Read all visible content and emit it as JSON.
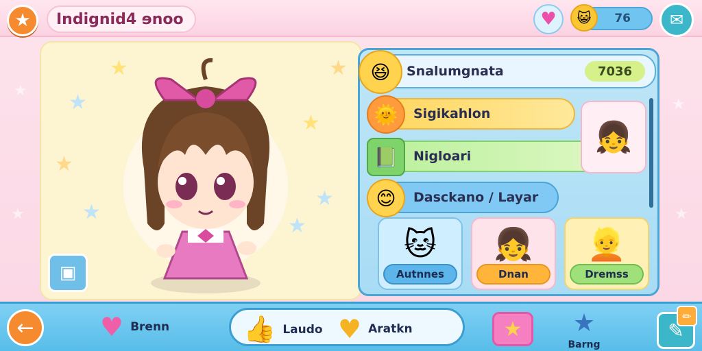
{
  "header": {
    "star_icon": "star-icon",
    "title": "Indignid4 ɘnoo",
    "heart_icon": "heart-icon",
    "coin_count": "76",
    "chat_icon": "chat-icon"
  },
  "menu": {
    "rows": [
      {
        "label": "Snalumgnata",
        "value": "7036"
      },
      {
        "label": "Sigikahlon"
      },
      {
        "label": "Nigloari"
      },
      {
        "label": "Dasckano / Layar"
      }
    ],
    "cards": [
      {
        "label": "Autnnes"
      },
      {
        "label": "Dnan"
      },
      {
        "label": "Dremss"
      }
    ]
  },
  "bottom": {
    "favorite_label": "Brenn",
    "like_label": "Laudo",
    "action_label": "Aratkn",
    "bg_label": "Barng"
  },
  "colors": {
    "accent_orange": "#f58a2e",
    "accent_blue": "#4aa5d6",
    "accent_pink": "#ec4fa7"
  }
}
